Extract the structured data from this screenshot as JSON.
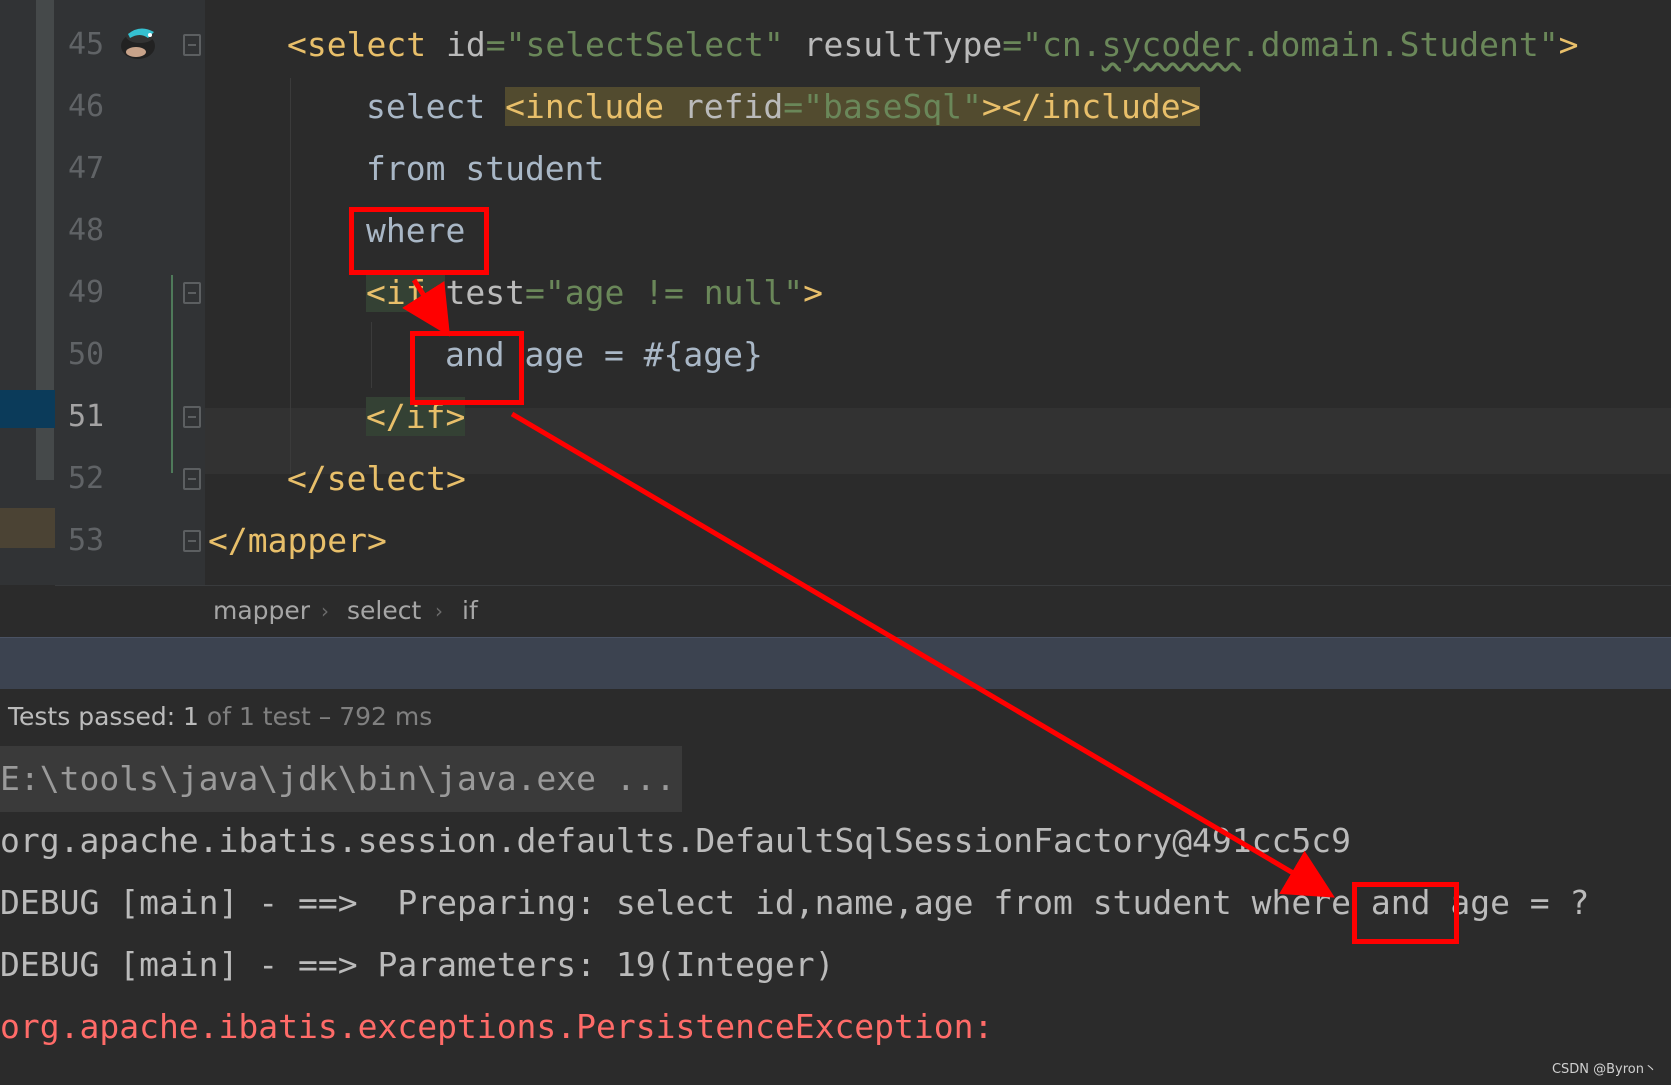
{
  "editor": {
    "lines": [
      {
        "num": "45"
      },
      {
        "num": "46"
      },
      {
        "num": "47"
      },
      {
        "num": "48"
      },
      {
        "num": "49"
      },
      {
        "num": "50"
      },
      {
        "num": "51"
      },
      {
        "num": "52"
      },
      {
        "num": "53"
      }
    ],
    "code": {
      "l45": {
        "t1": "<select ",
        "a1": "id",
        "eq1": "=",
        "s1": "\"selectSelect\"",
        "sp": " ",
        "a2": "resultType",
        "eq2": "=",
        "s2a": "\"cn.",
        "s2b": "sycoder",
        "s2c": ".domain.Student\"",
        "t2": ">"
      },
      "l46": {
        "kw": "select ",
        "t1": "<include ",
        "a1": "refid",
        "eq": "=",
        "s1": "\"baseSql\"",
        "t2": "></include>"
      },
      "l47": {
        "text": "from student"
      },
      "l48": {
        "text": "where"
      },
      "l49": {
        "t1": "<if ",
        "a1": "test",
        "eq": "=",
        "s1": "\"age != null\"",
        "t2": ">"
      },
      "l50": {
        "text": "and age = #{age}"
      },
      "l51": {
        "text": "</if>"
      },
      "l52": {
        "text": "</select>"
      },
      "l53": {
        "text": "</mapper>"
      }
    }
  },
  "breadcrumb": {
    "items": [
      "mapper",
      "select",
      "if"
    ],
    "separator": "›"
  },
  "test_status": {
    "passed_label": "Tests passed: 1",
    "rest": " of 1 test – 792 ms"
  },
  "console": {
    "lines": [
      "E:\\tools\\java\\jdk\\bin\\java.exe ...",
      "org.apache.ibatis.session.defaults.DefaultSqlSessionFactory@491cc5c9",
      "DEBUG [main] - ==>  Preparing: select id,name,age from student where and age = ?",
      "DEBUG [main] - ==> Parameters: 19(Integer)",
      "org.apache.ibatis.exceptions.PersistenceException:"
    ]
  },
  "watermark": "CSDN @Byron丶",
  "colors": {
    "annotation": "#ff0000",
    "tag": "#e8bf6a",
    "string": "#6a8759",
    "error": "#ff6b68"
  }
}
